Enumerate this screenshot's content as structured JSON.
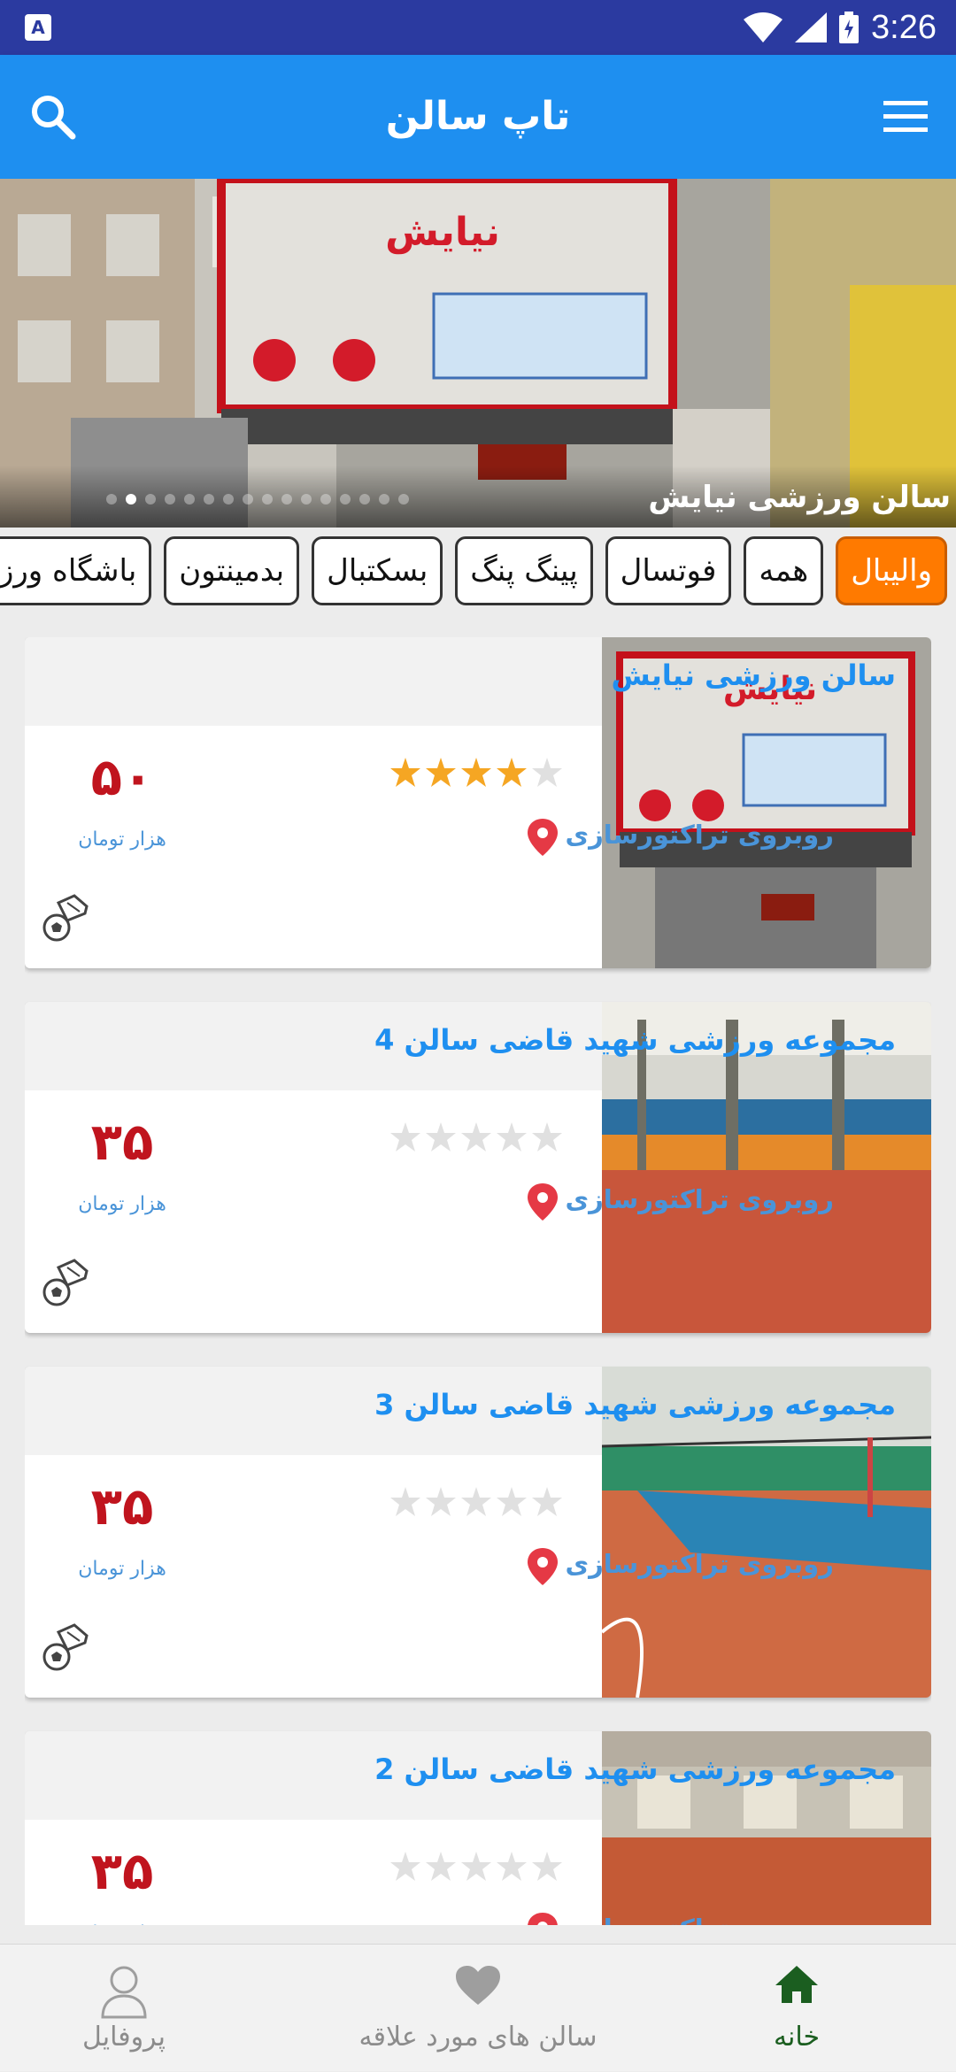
{
  "status_bar": {
    "time": "3:26"
  },
  "app_bar": {
    "title": "تاپ سالن",
    "search_icon": "search-icon",
    "menu_icon": "menu-icon"
  },
  "banner": {
    "caption": "سالن ورزشی نیایش",
    "slide_count": 16,
    "active_slide": 1
  },
  "filters": {
    "items": [
      "والیبال",
      "همه",
      "فوتسال",
      "پینگ پنگ",
      "بسکتبال",
      "بدمینتون",
      "باشگاه ورزشی"
    ],
    "selected": "والیبال"
  },
  "salons": [
    {
      "name": "سالن ورزشی نیایش",
      "rating": 4.5,
      "address": "روبروی تراکتورسازی",
      "price": "۵۰",
      "unit": "هزار تومان",
      "sport_icon": "soccer-shoe-ball-icon"
    },
    {
      "name": "مجموعه ورزشی شهید قاضی سالن 4",
      "rating": 0,
      "address": "روبروی تراکتورسازی",
      "price": "۳۵",
      "unit": "هزار تومان",
      "sport_icon": "soccer-shoe-ball-icon"
    },
    {
      "name": "مجموعه ورزشی شهید قاضی سالن 3",
      "rating": 0,
      "address": "روبروی تراکتورسازی",
      "price": "۳۵",
      "unit": "هزار تومان",
      "sport_icon": "soccer-shoe-ball-icon"
    },
    {
      "name": "مجموعه ورزشی شهید قاضی سالن 2",
      "rating": 0,
      "address": "روبروی تراکتورسازی",
      "price": "۳۵",
      "unit": "هزار تومان",
      "sport_icon": "soccer-shoe-ball-icon"
    }
  ],
  "bottom_nav": {
    "home": "خانه",
    "favorites": "سالن های مورد علاقه",
    "profile": "پروفایل",
    "active": "home"
  },
  "colors": {
    "primary": "#1e8ff0",
    "status_bar": "#2b3aa0",
    "accent": "#ff7a00",
    "price": "#c0141e",
    "active_nav": "#1b5e20"
  }
}
